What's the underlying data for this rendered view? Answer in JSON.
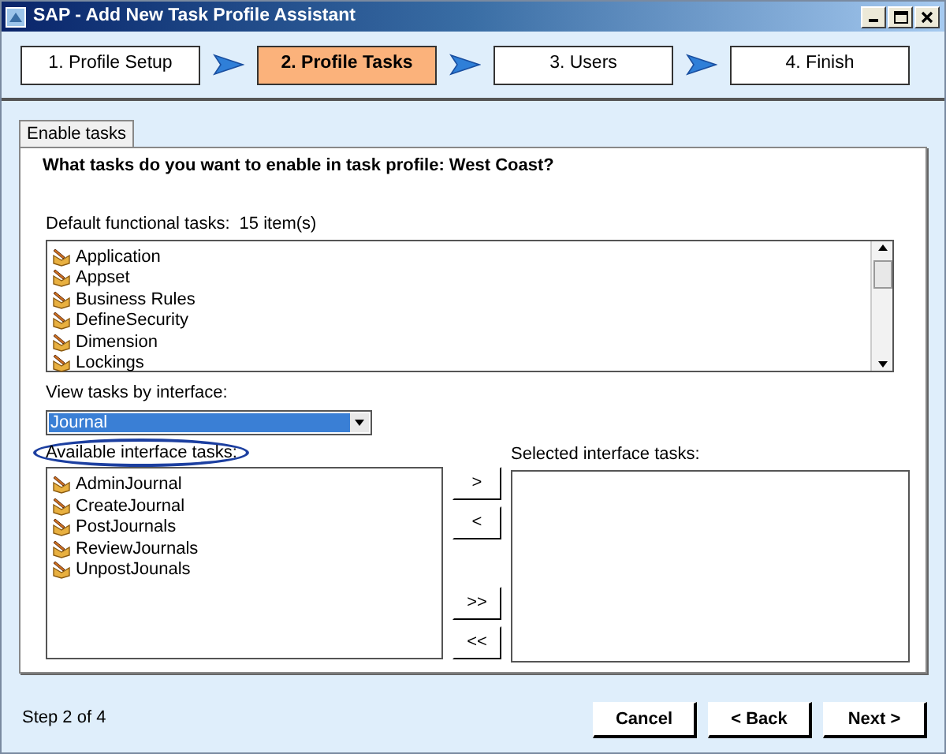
{
  "window": {
    "title": "SAP - Add New Task Profile Assistant"
  },
  "steps": [
    {
      "label": "1. Profile Setup",
      "selected": false
    },
    {
      "label": "2. Profile Tasks",
      "selected": true
    },
    {
      "label": "3. Users",
      "selected": false
    },
    {
      "label": "4. Finish",
      "selected": false
    }
  ],
  "tabs": [
    {
      "label": "Enable tasks",
      "selected": true
    }
  ],
  "question": "What tasks do you want to enable in task profile: West Coast?",
  "default_tasks": {
    "label": "Default functional tasks:",
    "count": "15 item(s)",
    "items": [
      "Application",
      "Appset",
      "Business Rules",
      "DefineSecurity",
      "Dimension",
      "Lockings"
    ]
  },
  "interface_select": {
    "label": "View tasks by interface:",
    "value": "Journal"
  },
  "available": {
    "label": "Available interface tasks:",
    "highlighted": true,
    "items": [
      "AdminJournal",
      "CreateJournal",
      "PostJournals",
      "ReviewJournals",
      "UnpostJounals"
    ]
  },
  "move_buttons": [
    ">",
    "<",
    ">>",
    "<<"
  ],
  "selected_tasks": {
    "label": "Selected interface tasks:"
  },
  "status": "Step 2 of 4",
  "buttons": [
    "Cancel",
    "< Back",
    "Next >"
  ]
}
